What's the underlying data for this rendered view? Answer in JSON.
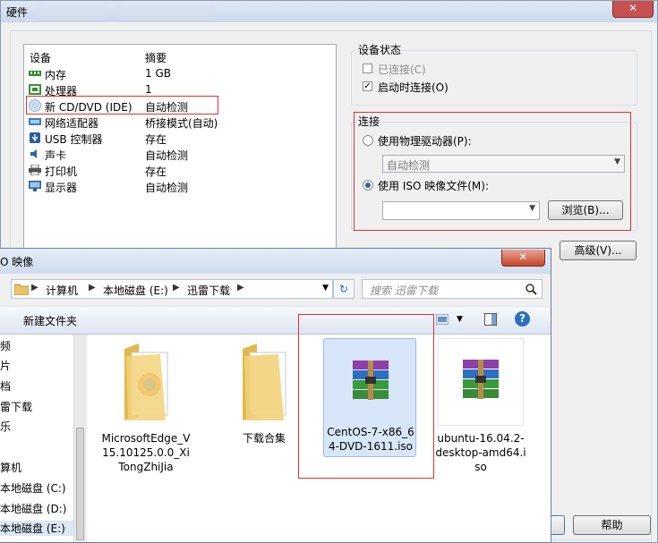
{
  "window": {
    "title": "硬件",
    "close": "✕"
  },
  "devices": {
    "headers": {
      "device": "设备",
      "summary": "摘要"
    },
    "rows": [
      {
        "name": "内存",
        "summary": "1 GB",
        "icon": "memory-icon",
        "color": "#2e8b2e"
      },
      {
        "name": "处理器",
        "summary": "1",
        "icon": "processor-icon",
        "color": "#3c8f3c"
      },
      {
        "name": "新 CD/DVD (IDE)",
        "summary": "自动检测",
        "icon": "cd-icon",
        "color": "#8fb7e0"
      },
      {
        "name": "网络适配器",
        "summary": "桥接模式(自动)",
        "icon": "network-icon",
        "color": "#3c7fbf"
      },
      {
        "name": "USB 控制器",
        "summary": "存在",
        "icon": "usb-icon",
        "color": "#2a5d9c"
      },
      {
        "name": "声卡",
        "summary": "自动检测",
        "icon": "sound-icon",
        "color": "#2a6aa8"
      },
      {
        "name": "打印机",
        "summary": "存在",
        "icon": "printer-icon",
        "color": "#555555"
      },
      {
        "name": "显示器",
        "summary": "自动检测",
        "icon": "monitor-icon",
        "color": "#2b5f95"
      }
    ]
  },
  "status": {
    "title": "设备状态",
    "connected_label": "已连接(C)",
    "connect_at_power_on_label": "启动时连接(O)",
    "check_mark": "✓"
  },
  "connection": {
    "title": "连接",
    "physical_label": "使用物理驱动器(P):",
    "physical_value": "自动检测",
    "iso_label": "使用 ISO 映像文件(M):",
    "iso_value": "",
    "browse_label": "浏览(B)...",
    "dropdown_arrow": "▼"
  },
  "advanced_label": "高级(V)...",
  "help_label": "帮助",
  "dialog": {
    "title": "O 映像",
    "close": "✕",
    "breadcrumbs": [
      "计算机",
      "本地磁盘 (E:)",
      "迅雷下载"
    ],
    "crumb_sep": "▶",
    "refresh": "↻",
    "search_placeholder": "搜索 迅雷下载",
    "search_icon": "🔍",
    "new_folder_label": "新建文件夹",
    "help_glyph": "?",
    "nav_items": [
      "视频",
      "图片",
      "文档",
      "迅雷下载",
      "音乐",
      "计算机",
      "本地磁盘 (C:)",
      "本地磁盘 (D:)",
      "本地磁盘 (E:)"
    ],
    "nav_visible": [
      "频",
      "片",
      "档",
      "雷下载",
      "乐",
      "算机",
      "本地磁盘 (C:)",
      "本地磁盘 (D:)",
      "本地磁盘 (E:)"
    ],
    "files": [
      {
        "name": "MicrosoftEdge_V15.10125.0.0_XiTongZhiJia",
        "type": "folder"
      },
      {
        "name": "下载合集",
        "type": "folder"
      },
      {
        "name": "CentOS-7-x86_64-DVD-1611.iso",
        "type": "archive",
        "selected": true
      },
      {
        "name": "ubuntu-16.04.2-desktop-amd64.iso",
        "type": "archive"
      }
    ]
  }
}
